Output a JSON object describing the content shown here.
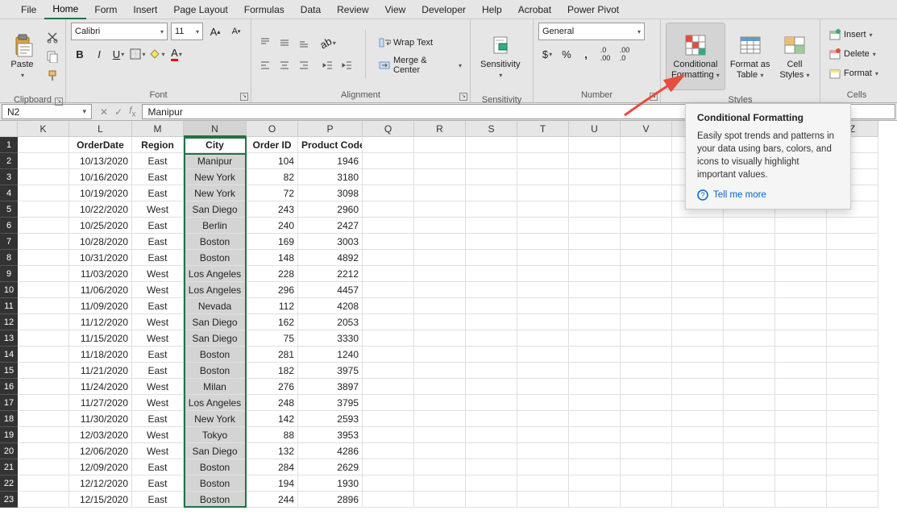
{
  "menu": [
    "File",
    "Home",
    "Form",
    "Insert",
    "Page Layout",
    "Formulas",
    "Data",
    "Review",
    "View",
    "Developer",
    "Help",
    "Acrobat",
    "Power Pivot"
  ],
  "menu_active": 1,
  "ribbon": {
    "clipboard": {
      "paste": "Paste",
      "label": "Clipboard"
    },
    "font": {
      "name": "Calibri",
      "size": "11",
      "label": "Font"
    },
    "alignment": {
      "wrap": "Wrap Text",
      "merge": "Merge & Center",
      "label": "Alignment"
    },
    "sensitivity": {
      "btn": "Sensitivity",
      "label": "Sensitivity"
    },
    "number": {
      "format": "General",
      "label": "Number"
    },
    "styles": {
      "cf": "Conditional\nFormatting",
      "fat": "Format as\nTable",
      "cs": "Cell\nStyles",
      "label": "Styles"
    },
    "cells": {
      "insert": "Insert",
      "delete": "Delete",
      "format": "Format",
      "label": "Cells"
    }
  },
  "namebox": "N2",
  "formula": "Manipur",
  "cols": [
    "K",
    "L",
    "M",
    "N",
    "O",
    "P",
    "Q",
    "R",
    "S",
    "T",
    "U",
    "V",
    "W",
    "X",
    "Y",
    "Z"
  ],
  "headers": {
    "L": "OrderDate",
    "M": "Region",
    "N": "City",
    "O": "Order ID",
    "P": "Product Code"
  },
  "rows": [
    {
      "L": "10/13/2020",
      "M": "East",
      "N": "Manipur",
      "O": "104",
      "P": "1946"
    },
    {
      "L": "10/16/2020",
      "M": "East",
      "N": "New York",
      "O": "82",
      "P": "3180"
    },
    {
      "L": "10/19/2020",
      "M": "East",
      "N": "New York",
      "O": "72",
      "P": "3098"
    },
    {
      "L": "10/22/2020",
      "M": "West",
      "N": "San Diego",
      "O": "243",
      "P": "2960"
    },
    {
      "L": "10/25/2020",
      "M": "East",
      "N": "Berlin",
      "O": "240",
      "P": "2427"
    },
    {
      "L": "10/28/2020",
      "M": "East",
      "N": "Boston",
      "O": "169",
      "P": "3003"
    },
    {
      "L": "10/31/2020",
      "M": "East",
      "N": "Boston",
      "O": "148",
      "P": "4892"
    },
    {
      "L": "11/03/2020",
      "M": "West",
      "N": "Los Angeles",
      "O": "228",
      "P": "2212"
    },
    {
      "L": "11/06/2020",
      "M": "West",
      "N": "Los Angeles",
      "O": "296",
      "P": "4457"
    },
    {
      "L": "11/09/2020",
      "M": "East",
      "N": "Nevada",
      "O": "112",
      "P": "4208"
    },
    {
      "L": "11/12/2020",
      "M": "West",
      "N": "San Diego",
      "O": "162",
      "P": "2053"
    },
    {
      "L": "11/15/2020",
      "M": "West",
      "N": "San Diego",
      "O": "75",
      "P": "3330"
    },
    {
      "L": "11/18/2020",
      "M": "East",
      "N": "Boston",
      "O": "281",
      "P": "1240"
    },
    {
      "L": "11/21/2020",
      "M": "East",
      "N": "Boston",
      "O": "182",
      "P": "3975"
    },
    {
      "L": "11/24/2020",
      "M": "West",
      "N": "Milan",
      "O": "276",
      "P": "3897"
    },
    {
      "L": "11/27/2020",
      "M": "West",
      "N": "Los Angeles",
      "O": "248",
      "P": "3795"
    },
    {
      "L": "11/30/2020",
      "M": "East",
      "N": "New York",
      "O": "142",
      "P": "2593"
    },
    {
      "L": "12/03/2020",
      "M": "West",
      "N": "Tokyo",
      "O": "88",
      "P": "3953"
    },
    {
      "L": "12/06/2020",
      "M": "West",
      "N": "San Diego",
      "O": "132",
      "P": "4286"
    },
    {
      "L": "12/09/2020",
      "M": "East",
      "N": "Boston",
      "O": "284",
      "P": "2629"
    },
    {
      "L": "12/12/2020",
      "M": "East",
      "N": "Boston",
      "O": "194",
      "P": "1930"
    },
    {
      "L": "12/15/2020",
      "M": "East",
      "N": "Boston",
      "O": "244",
      "P": "2896"
    }
  ],
  "tooltip": {
    "title": "Conditional Formatting",
    "body": "Easily spot trends and patterns in your data using bars, colors, and icons to visually highlight important values.",
    "link": "Tell me more"
  }
}
